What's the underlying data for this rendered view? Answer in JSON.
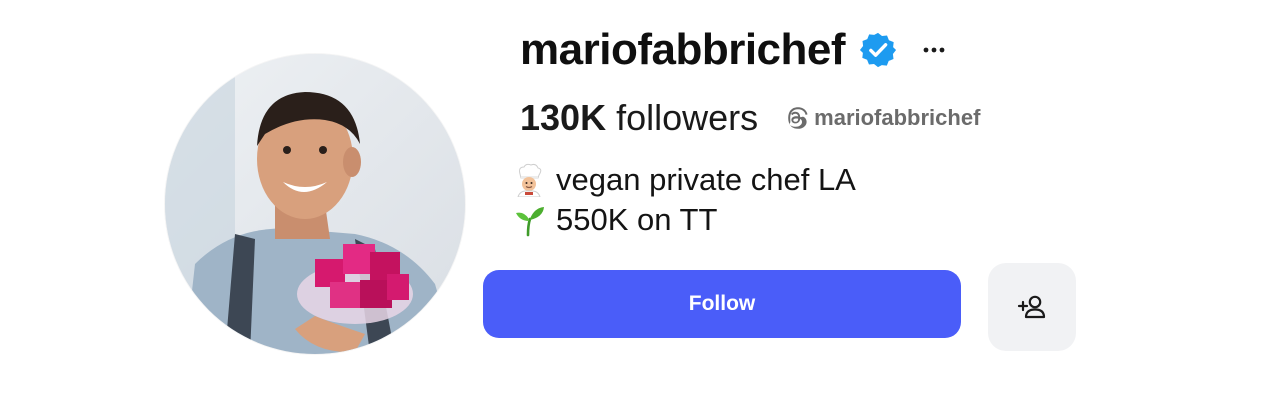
{
  "profile": {
    "username": "mariofabbrichef",
    "verified": true,
    "followers_count": "130K",
    "followers_label": "followers",
    "threads_handle": "mariofabbrichef",
    "bio": [
      {
        "icon": "chef-emoji",
        "text": "vegan private chef LA"
      },
      {
        "icon": "seedling-emoji",
        "text": "550K on TT"
      }
    ]
  },
  "actions": {
    "follow_label": "Follow",
    "add_friend_icon": "add-person-icon",
    "more_icon": "more-options-icon"
  },
  "colors": {
    "follow_button": "#4a5df9",
    "verified_badge": "#1d9bf0",
    "secondary_button_bg": "#f1f2f4",
    "muted_text": "#6b6b6b"
  }
}
